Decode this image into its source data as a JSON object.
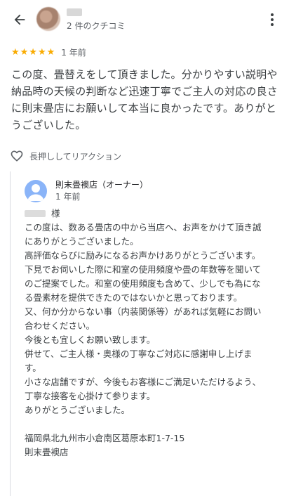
{
  "header": {
    "review_count": "2 件のクチコミ",
    "icons": {
      "back": "back-arrow-icon",
      "more": "more-vert-icon"
    }
  },
  "review": {
    "rating": 5,
    "stars": "★★★★★",
    "time": "1 年前",
    "text": "この度、畳替えをして頂きました。分かりやすい説明や納品時の天候の判断など迅速丁寧でご主人の対応の良さに則末畳店にお願いして本当に良かったです。ありがとうございした。",
    "reaction_label": "長押ししてリアクション"
  },
  "owner_reply": {
    "owner_name": "則末畳襖店（オーナー）",
    "time": "1 年前",
    "greeting_suffix": "様",
    "lines": [
      "この度は、数ある畳店の中から当店へ、お声をかけて頂き誠にありがとうございました。",
      "高評価ならびに励みになるお声かけありがとうございます。",
      "下見でお伺いした際に和室の使用頻度や畳の年数等を聞いてのご提案でした。和室の使用頻度も含めて、少しでも為になる畳素材を提供できたのではないかと思っております。",
      "又、何か分からない事（内装関係等）があれば気軽にお問い合わせください。",
      "今後とも宜しくお願い致します。",
      "併せて、ご主人様・奥様の丁寧なご対応に感謝申し上げます。",
      "小さな店舗ですが、今後もお客様にご満足いただけるよう、丁寧な接客を心掛けて参ります。",
      "ありがとうございました。"
    ],
    "address": "福岡県北九州市小倉南区葛原本町1-7-15",
    "signature": "則末畳襖店"
  },
  "colors": {
    "star": "#f9ab00",
    "avatar": "#8ab4f8",
    "text": "#3c4043",
    "secondary": "#5f6368"
  }
}
